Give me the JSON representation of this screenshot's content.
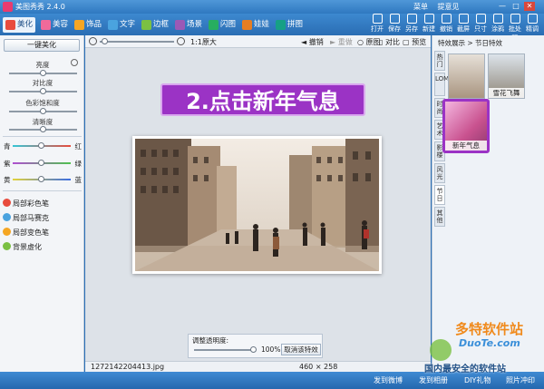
{
  "app": {
    "title": "美图秀秀 2.4.0",
    "links": [
      "菜单",
      "提意见"
    ]
  },
  "nav_tabs": [
    {
      "label": "美化",
      "active": true,
      "icon_color": "#e84c3d"
    },
    {
      "label": "美容",
      "active": false,
      "icon_color": "#f06a9a"
    },
    {
      "label": "饰品",
      "active": false,
      "icon_color": "#f5a623"
    },
    {
      "label": "文字",
      "active": false,
      "icon_color": "#4aa3df"
    },
    {
      "label": "边框",
      "active": false,
      "icon_color": "#7bc043"
    },
    {
      "label": "场景",
      "active": false,
      "icon_color": "#9b59b6"
    },
    {
      "label": "闪图",
      "active": false,
      "icon_color": "#27ae60"
    },
    {
      "label": "娃娃",
      "active": false,
      "icon_color": "#e67e22"
    },
    {
      "label": "拼图",
      "active": false,
      "icon_color": "#16a085"
    }
  ],
  "toolbar": [
    "打开",
    "保存",
    "另存",
    "新建",
    "撤销",
    "截屏",
    "只寸",
    "涂鸦",
    "批处理",
    "精调"
  ],
  "left_panel": {
    "onekey": "一键美化",
    "sliders": [
      "亮度",
      "对比度",
      "色彩饱和度",
      "清晰度"
    ],
    "color_rows": [
      {
        "left": "青",
        "right": "红"
      },
      {
        "left": "紫",
        "right": "绿"
      },
      {
        "left": "黄",
        "right": "蓝"
      }
    ],
    "tools": [
      {
        "label": "局部彩色笔",
        "color": "#e84c3d"
      },
      {
        "label": "局部马赛克",
        "color": "#4aa3df"
      },
      {
        "label": "局部变色笔",
        "color": "#f5a623"
      },
      {
        "label": "背景虚化",
        "color": "#7bc043"
      }
    ]
  },
  "canvas_toolbar": {
    "zoom": "1:1原大",
    "undo": "撤销",
    "redo": "重做",
    "original": "原图",
    "compare": "对比",
    "preview": "预览"
  },
  "overlay": {
    "step": "2.点击新年气息"
  },
  "opacity": {
    "label": "调整透明度:",
    "value": "100%",
    "cancel": "取消该特效"
  },
  "status": {
    "filename": "1272142204413.jpg",
    "dimensions": "460 × 258"
  },
  "right_panel": {
    "breadcrumb": "特效展示 > 节日特效",
    "side_tabs": [
      "热门",
      "LOMO",
      "时尚",
      "艺术",
      "影楼",
      "风光",
      "节日",
      "其他"
    ],
    "thumbs": [
      {
        "caption": ""
      },
      {
        "caption": "雪花飞舞"
      },
      {
        "caption": "新年气息"
      }
    ]
  },
  "bottom_bar": {
    "items": [
      "发到微博",
      "发到相册",
      "DIY礼物",
      "照片冲印"
    ]
  },
  "watermark": {
    "brand": "多特软件站",
    "url": "DuoTe.com",
    "slogan": "国内最安全的软件站"
  }
}
